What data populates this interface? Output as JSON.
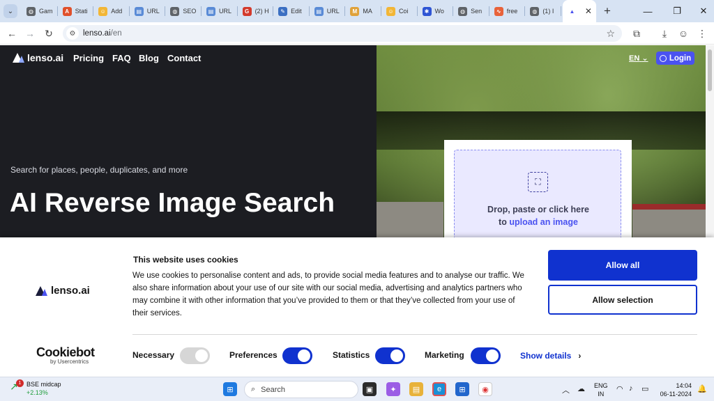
{
  "browser": {
    "tabs": [
      {
        "label": "Gam",
        "icon": "globe-icon",
        "color": "#5f6368"
      },
      {
        "label": "Stati",
        "icon": "a-icon",
        "color": "#e0502b"
      },
      {
        "label": "Add",
        "icon": "smiley-icon",
        "color": "#f2b636"
      },
      {
        "label": "URL",
        "icon": "page-icon",
        "color": "#5a8bd6"
      },
      {
        "label": "SEO",
        "icon": "globe-icon",
        "color": "#5f6368"
      },
      {
        "label": "URL",
        "icon": "page-icon",
        "color": "#5a8bd6"
      },
      {
        "label": "(2) H",
        "icon": "g-icon",
        "color": "#d33a2c"
      },
      {
        "label": "Edit",
        "icon": "edit-icon",
        "color": "#3b6fc2"
      },
      {
        "label": "URL",
        "icon": "page-icon",
        "color": "#5a8bd6"
      },
      {
        "label": "MA",
        "icon": "m-icon",
        "color": "#e0a23a"
      },
      {
        "label": "Coi",
        "icon": "smiley-icon",
        "color": "#f2b636"
      },
      {
        "label": "Wo",
        "icon": "asterisk-icon",
        "color": "#2f55d4"
      },
      {
        "label": "Sen",
        "icon": "globe-icon",
        "color": "#5f6368"
      },
      {
        "label": "free",
        "icon": "wave-icon",
        "color": "#e8623a"
      },
      {
        "label": "(1) I",
        "icon": "globe-icon",
        "color": "#5f6368"
      }
    ],
    "url_host": "lenso.ai",
    "url_path": "/en"
  },
  "site": {
    "logo": "lenso.ai",
    "nav": [
      "Pricing",
      "FAQ",
      "Blog",
      "Contact"
    ],
    "lang": "EN",
    "login": "Login",
    "hero_sub": "Search for places, people, duplicates, and more",
    "hero_title": "AI Reverse Image Search",
    "upload_line1": "Drop, paste or click here",
    "upload_line2_prefix": "to",
    "upload_link": "upload an image",
    "accent_color": "#4a52f0"
  },
  "cookie": {
    "brand": "lenso.ai",
    "title": "This website uses cookies",
    "body": "We use cookies to personalise content and ads, to provide social media features and to analyse our traffic. We also share information about your use of our site with our social media, advertising and analytics partners who may combine it with other information that you’ve provided to them or that they’ve collected from your use of their services.",
    "allow_all": "Allow all",
    "allow_selection": "Allow selection",
    "cookiebot": "Cookiebot",
    "cookiebot_by": "by Usercentrics",
    "prefs": [
      {
        "label": "Necessary",
        "on": false
      },
      {
        "label": "Preferences",
        "on": true
      },
      {
        "label": "Statistics",
        "on": true
      },
      {
        "label": "Marketing",
        "on": true
      }
    ],
    "show_details": "Show details",
    "button_color": "#1032cf"
  },
  "taskbar": {
    "stock_badge": "1",
    "stock_name": "BSE midcap",
    "stock_change": "+2.13%",
    "search_placeholder": "Search",
    "lang_top": "ENG",
    "lang_bottom": "IN",
    "time": "14:04",
    "date": "06-11-2024"
  }
}
